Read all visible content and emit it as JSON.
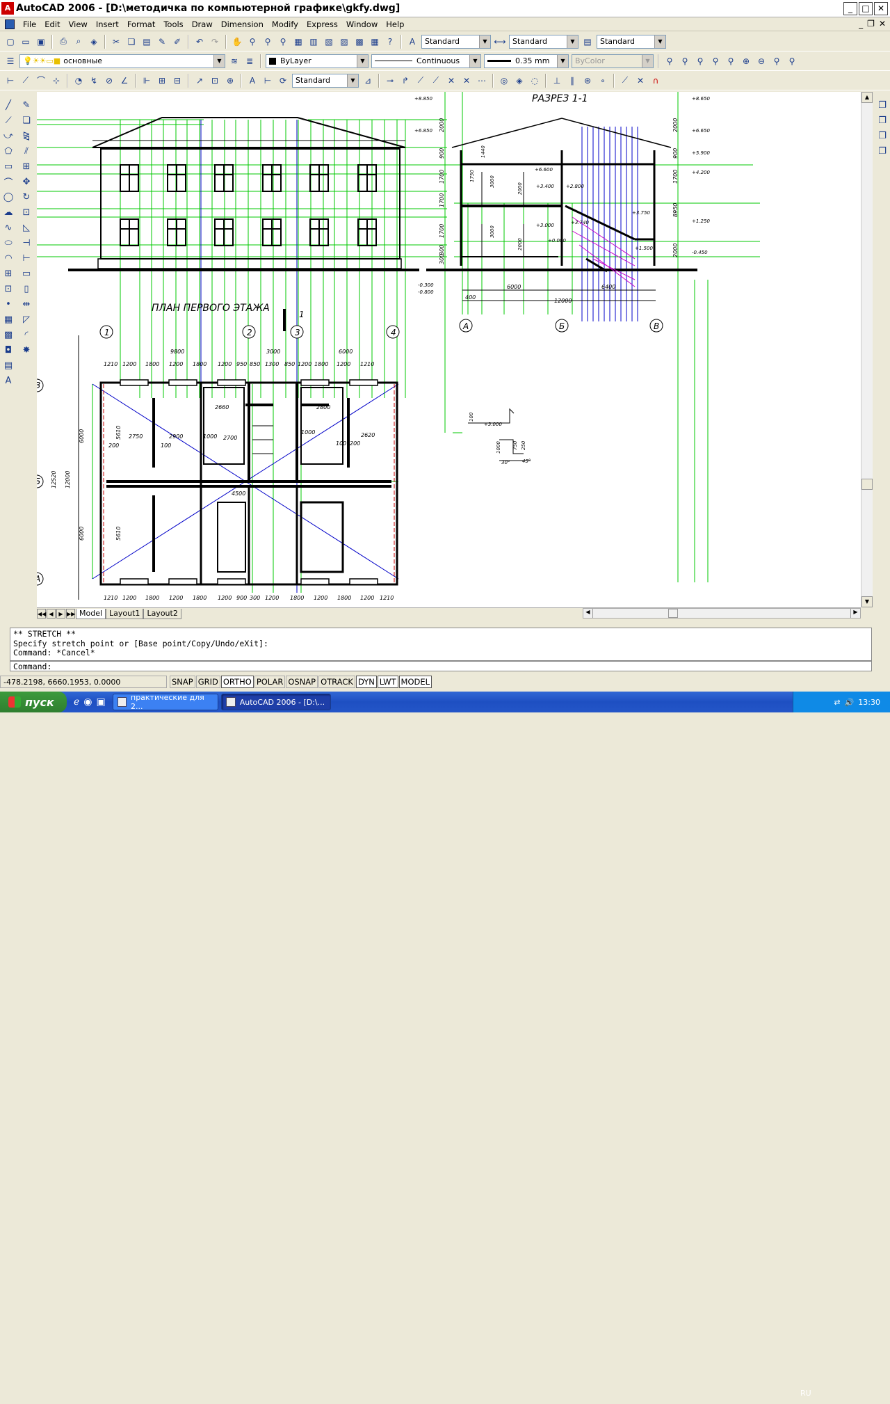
{
  "window": {
    "title": "AutoCAD 2006 - [D:\\методичка по компьютерной графике\\gkfy.dwg]",
    "app_icon": "autocad-logo-icon",
    "buttons": [
      "minimize-icon",
      "maximize-icon",
      "close-icon"
    ]
  },
  "menu": [
    "File",
    "Edit",
    "View",
    "Insert",
    "Format",
    "Tools",
    "Draw",
    "Dimension",
    "Modify",
    "Express",
    "Window",
    "Help"
  ],
  "styles_toolbar": {
    "text_style": "Standard",
    "dim_style": "Standard",
    "table_style": "Standard"
  },
  "layers_toolbar": {
    "layer": "основные",
    "color": "ByLayer",
    "linetype": "Continuous",
    "lineweight": "0.35 mm",
    "plotstyle": "ByColor"
  },
  "dim_toolbar": {
    "dimstyle": "Standard"
  },
  "drawing": {
    "section_title": "РАЗРЕЗ 1-1",
    "plan_title": "ПЛАН ПЕРВОГО ЭТАЖА",
    "section_mark": "1",
    "axis_numbers": [
      "1",
      "2",
      "3",
      "4"
    ],
    "axis_letters": [
      "А",
      "Б",
      "В"
    ],
    "plan_axis_letters": [
      "В",
      "Б",
      "А"
    ],
    "top_dims_1": [
      "9800",
      "3000",
      "6000"
    ],
    "top_dims_2": [
      "1210",
      "1200",
      "1800",
      "1200",
      "1800",
      "1200",
      "950",
      "850",
      "1300",
      "850",
      "1200",
      "1800",
      "1200",
      "1210"
    ],
    "bottom_dims": [
      "1210",
      "1200",
      "1800",
      "1200",
      "1800",
      "1200",
      "900",
      "300",
      "1200",
      "1800",
      "1200",
      "1800",
      "1200",
      "1210"
    ],
    "section_elev_left": [
      "+8.850",
      "+6.850",
      "-0.300",
      "-0.800"
    ],
    "section_elev_right": [
      "+8.650",
      "+6.650",
      "+5.900",
      "+4.200",
      "+1.250",
      "-0.450"
    ],
    "section_dims_left": [
      "2000",
      "900",
      "1700",
      "1700",
      "1700",
      "800",
      "300"
    ],
    "section_dims_right": [
      "2000",
      "900",
      "1700",
      "8950",
      "2000"
    ],
    "section_inner_labels": [
      "1440",
      "1750",
      "3000",
      "2000",
      "3000",
      "2000",
      "+6.600",
      "+3.400",
      "+3.000",
      "+2.800",
      "+3.740",
      "+0.000",
      "+3.750",
      "+1.500"
    ],
    "section_bottom_dims": [
      "6000",
      "6400",
      "400",
      "12000"
    ],
    "plan_room_dims": [
      "2660",
      "2750",
      "2900",
      "2800",
      "2700",
      "2620",
      "4500",
      "1000",
      "1000",
      "100",
      "100",
      "200",
      "200",
      "5610",
      "5610",
      "6000",
      "6000",
      "12520",
      "12000"
    ],
    "detail_labels": [
      "100",
      "+3.000",
      "750",
      "1000",
      "250",
      "30°",
      "45°"
    ]
  },
  "tabs": [
    "Model",
    "Layout1",
    "Layout2"
  ],
  "command_history": [
    "** STRETCH **",
    "Specify stretch point or [Base point/Copy/Undo/eXit]:",
    "Command: *Cancel*"
  ],
  "command_prompt": "Command:",
  "status": {
    "coords": "-478.2198, 6660.1953, 0.0000",
    "toggles": [
      "SNAP",
      "GRID",
      "ORTHO",
      "POLAR",
      "OSNAP",
      "OTRACK",
      "DYN",
      "LWT",
      "MODEL"
    ],
    "active_toggles": [
      "ORTHO",
      "DYN",
      "LWT",
      "MODEL"
    ]
  },
  "taskbar": {
    "start": "пуск",
    "items": [
      "практические для 2...",
      "AutoCAD 2006 - [D:\\..."
    ],
    "lang": "RU",
    "time": "13:30"
  }
}
